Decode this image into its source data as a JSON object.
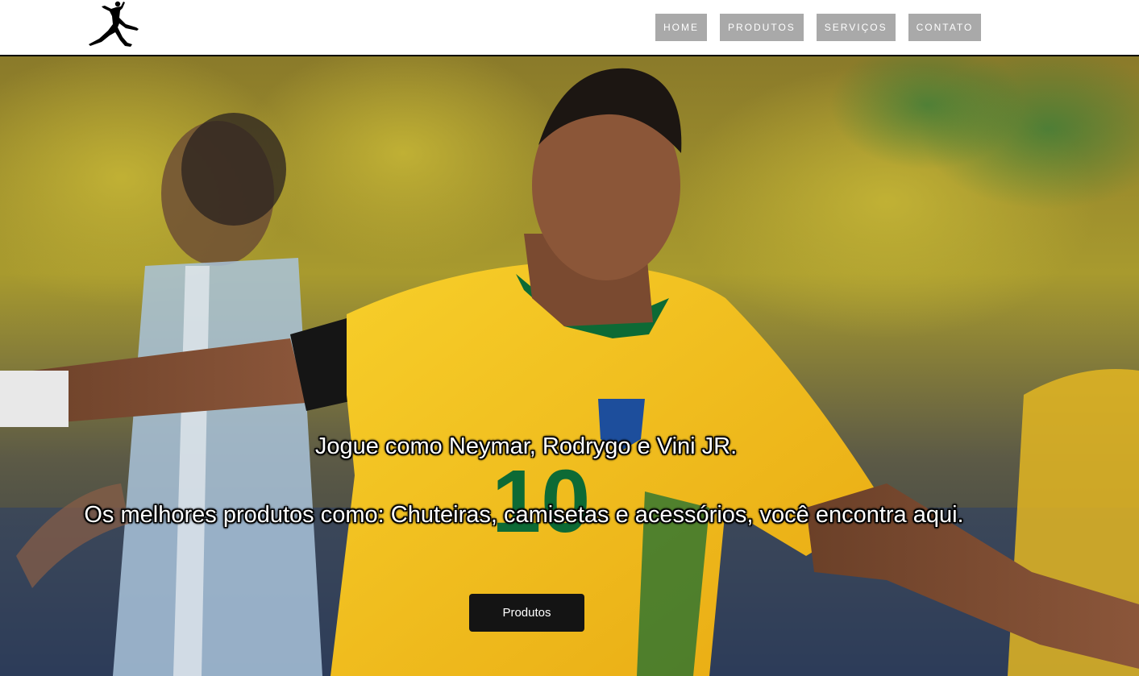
{
  "header": {
    "logo_icon": "jumpman-logo-icon",
    "nav": [
      {
        "label": "HOME"
      },
      {
        "label": "PRODUTOS"
      },
      {
        "label": "SERVIÇOS"
      },
      {
        "label": "CONTATO"
      }
    ]
  },
  "hero": {
    "headline": "Jogue como Neymar, Rodrygo e Vini JR.",
    "subtitle": "Os melhores produtos como: Chuteiras, camisetas e acessórios, você encontra aqui.",
    "cta_label": "Produtos"
  },
  "colors": {
    "nav_bg": "#a9a9a9",
    "cta_bg": "#141414",
    "jersey_yellow": "#f2c21b",
    "jersey_green": "#0a7a3a"
  }
}
